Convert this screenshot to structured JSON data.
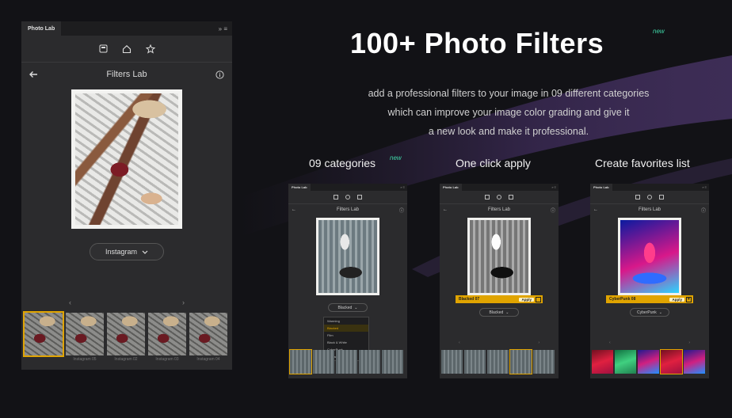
{
  "hero": {
    "title": "100+ Photo Filters",
    "new_badge": "new",
    "description_lines": [
      "add a professional filters to your image in 09 different categories",
      "which can improve your image color grading and  give it",
      "a new look and make it professional."
    ]
  },
  "features": [
    {
      "label": "09 categories",
      "badge": "new"
    },
    {
      "label": "One click apply"
    },
    {
      "label": "Create favorites list"
    }
  ],
  "main_panel": {
    "tab": "Photo Lab",
    "tab_controls": "»  ≡",
    "title": "Filters Lab",
    "preset": "Instagram",
    "thumbs": [
      "",
      "Instagram 05",
      "Instagram 02",
      "Instagram 03",
      "Instagram 04"
    ]
  },
  "mini_panels": [
    {
      "tab": "Photo Lab",
      "title": "Filters Lab",
      "preset": "Blacked",
      "dropdown": [
        "Warming",
        "Blacked",
        "Film",
        "Black & White",
        "CyberPunk",
        "Portraits"
      ],
      "dropdown_selected": 1
    },
    {
      "tab": "Photo Lab",
      "title": "Filters Lab",
      "apply_name": "Blacked 07",
      "apply_label": "Apply",
      "preset": "Blacked"
    },
    {
      "tab": "Photo Lab",
      "title": "Filters Lab",
      "apply_name": "CyberPunk 08",
      "apply_label": "Apply",
      "fav_icon": "♥",
      "preset": "CyberPunk"
    }
  ],
  "colors": {
    "accent": "#e0a400",
    "badge": "#3fd6a8",
    "background": "#121216",
    "panel": "#2b2b2d"
  },
  "icons": [
    "save-icon",
    "home-icon",
    "star-icon",
    "back-arrow-icon",
    "info-icon",
    "chevron-down-icon",
    "chevron-left-icon",
    "chevron-right-icon",
    "heart-icon"
  ]
}
